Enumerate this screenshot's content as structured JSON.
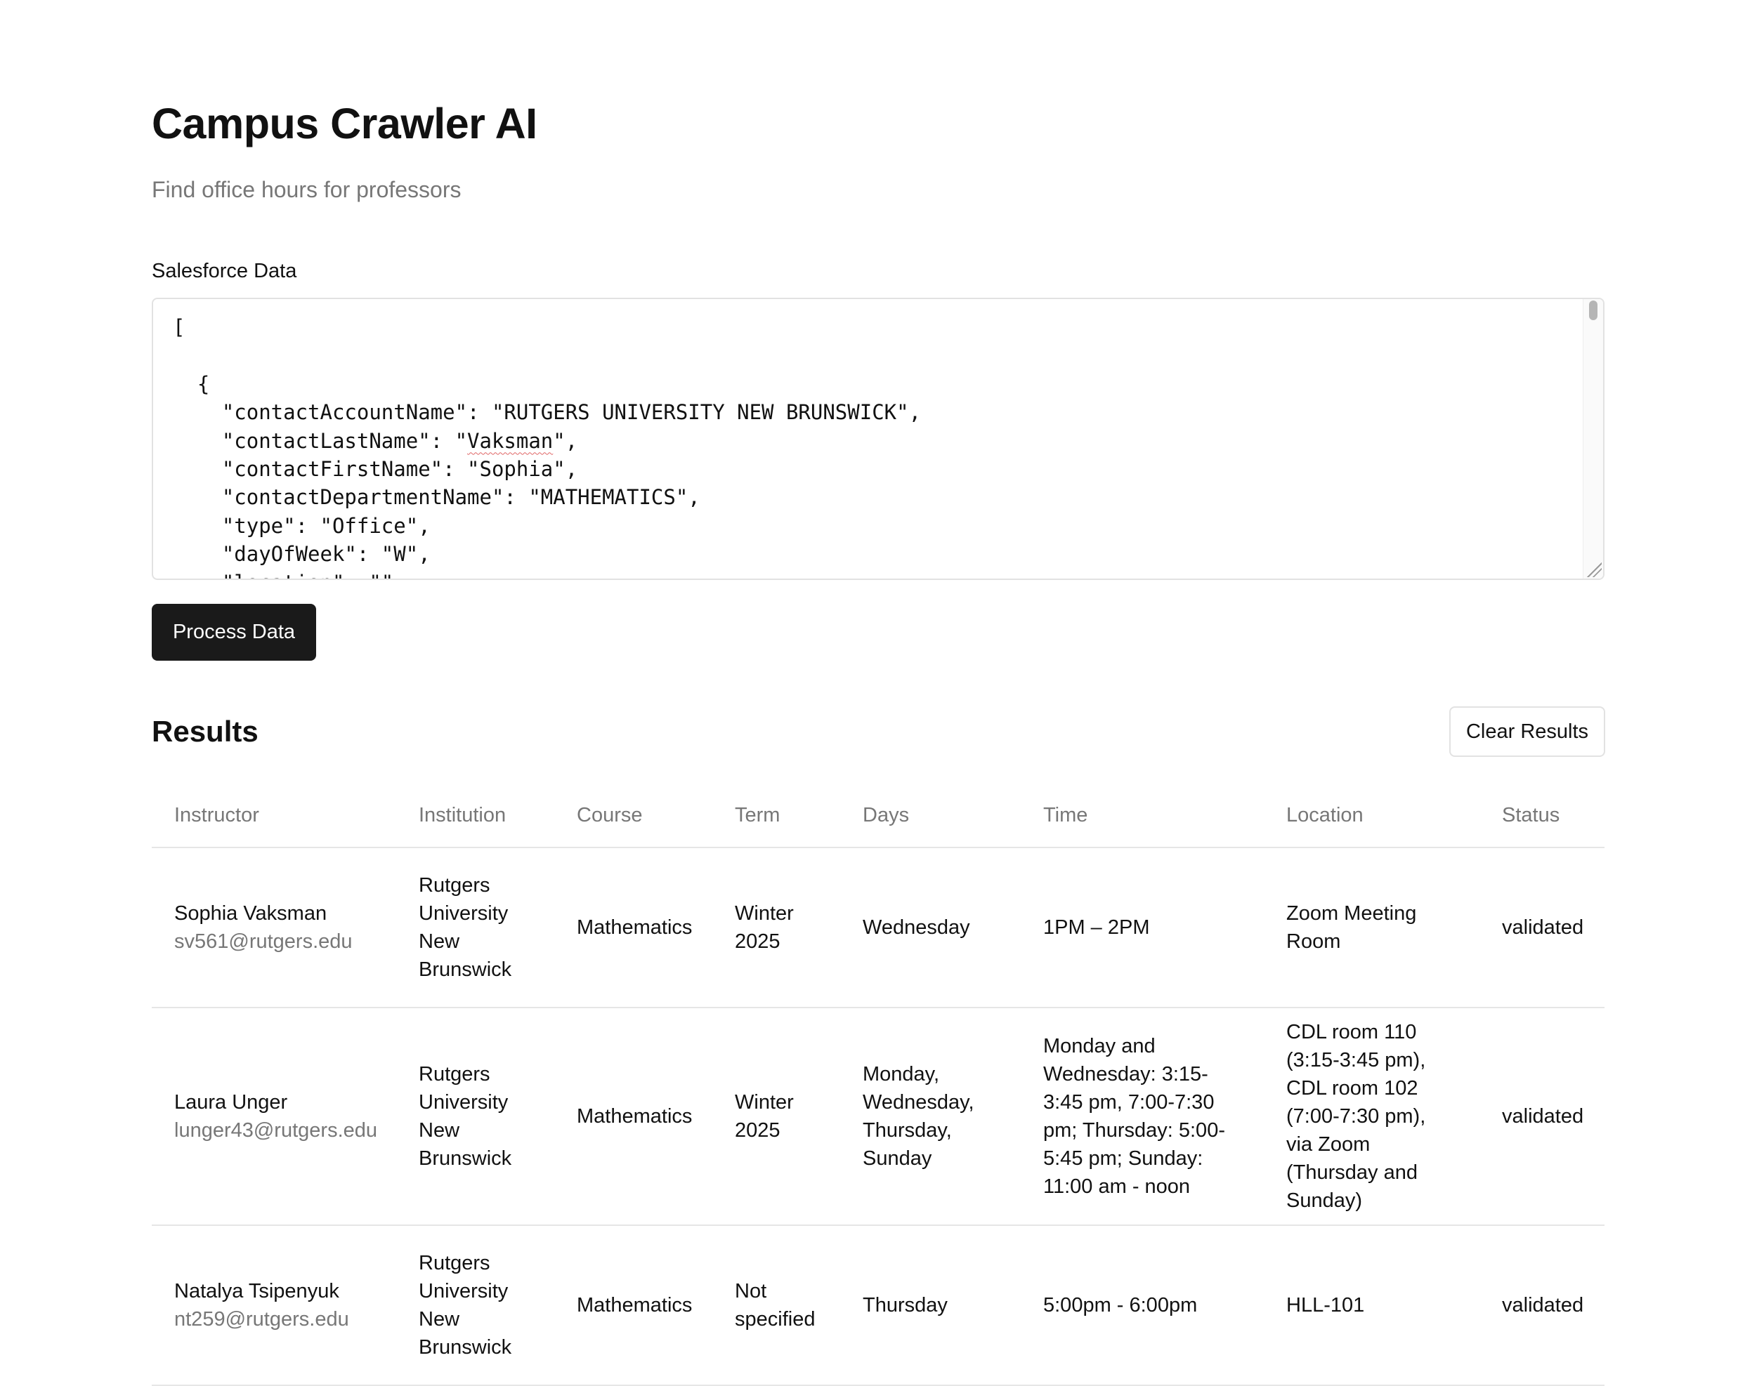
{
  "app": {
    "title": "Campus Crawler AI",
    "subtitle": "Find office hours for professors"
  },
  "input": {
    "label": "Salesforce Data",
    "json_lines": [
      "[",
      "",
      "  {",
      "    \"contactAccountName\": \"RUTGERS UNIVERSITY NEW BRUNSWICK\",",
      "    \"contactLastName\": \"Vaksman\",",
      "    \"contactFirstName\": \"Sophia\",",
      "    \"contactDepartmentName\": \"MATHEMATICS\",",
      "    \"type\": \"Office\",",
      "    \"dayOfWeek\": \"W\",",
      "    \"location\": \"\","
    ],
    "process_button": "Process Data"
  },
  "results": {
    "heading": "Results",
    "clear_button": "Clear Results",
    "columns": [
      "Instructor",
      "Institution",
      "Course",
      "Term",
      "Days",
      "Time",
      "Location",
      "Status"
    ],
    "rows": [
      {
        "instructor_name": "Sophia Vaksman",
        "instructor_email": "sv561@rutgers.edu",
        "institution": "Rutgers University New Brunswick",
        "course": "Mathematics",
        "term": "Winter 2025",
        "days": "Wednesday",
        "time": "1PM – 2PM",
        "location": "Zoom Meeting Room",
        "status": "validated"
      },
      {
        "instructor_name": "Laura Unger",
        "instructor_email": "lunger43@rutgers.edu",
        "institution": "Rutgers University New Brunswick",
        "course": "Mathematics",
        "term": "Winter 2025",
        "days": "Monday, Wednesday, Thursday, Sunday",
        "time": "Monday and Wednesday: 3:15-3:45 pm, 7:00-7:30 pm; Thursday: 5:00-5:45 pm; Sunday: 11:00 am - noon",
        "location": "CDL room 110 (3:15-3:45 pm), CDL room 102 (7:00-7:30 pm), via Zoom (Thursday and Sunday)",
        "status": "validated"
      },
      {
        "instructor_name": "Natalya Tsipenyuk",
        "instructor_email": "nt259@rutgers.edu",
        "institution": "Rutgers University New Brunswick",
        "course": "Mathematics",
        "term": "Not specified",
        "days": "Thursday",
        "time": "5:00pm - 6:00pm",
        "location": "HLL-101",
        "status": "validated"
      }
    ]
  },
  "colors": {
    "primary_button_bg": "#1a1a1a",
    "status_validated": "#3d9a47",
    "muted_text": "#777777",
    "border": "#e2e2e2"
  }
}
